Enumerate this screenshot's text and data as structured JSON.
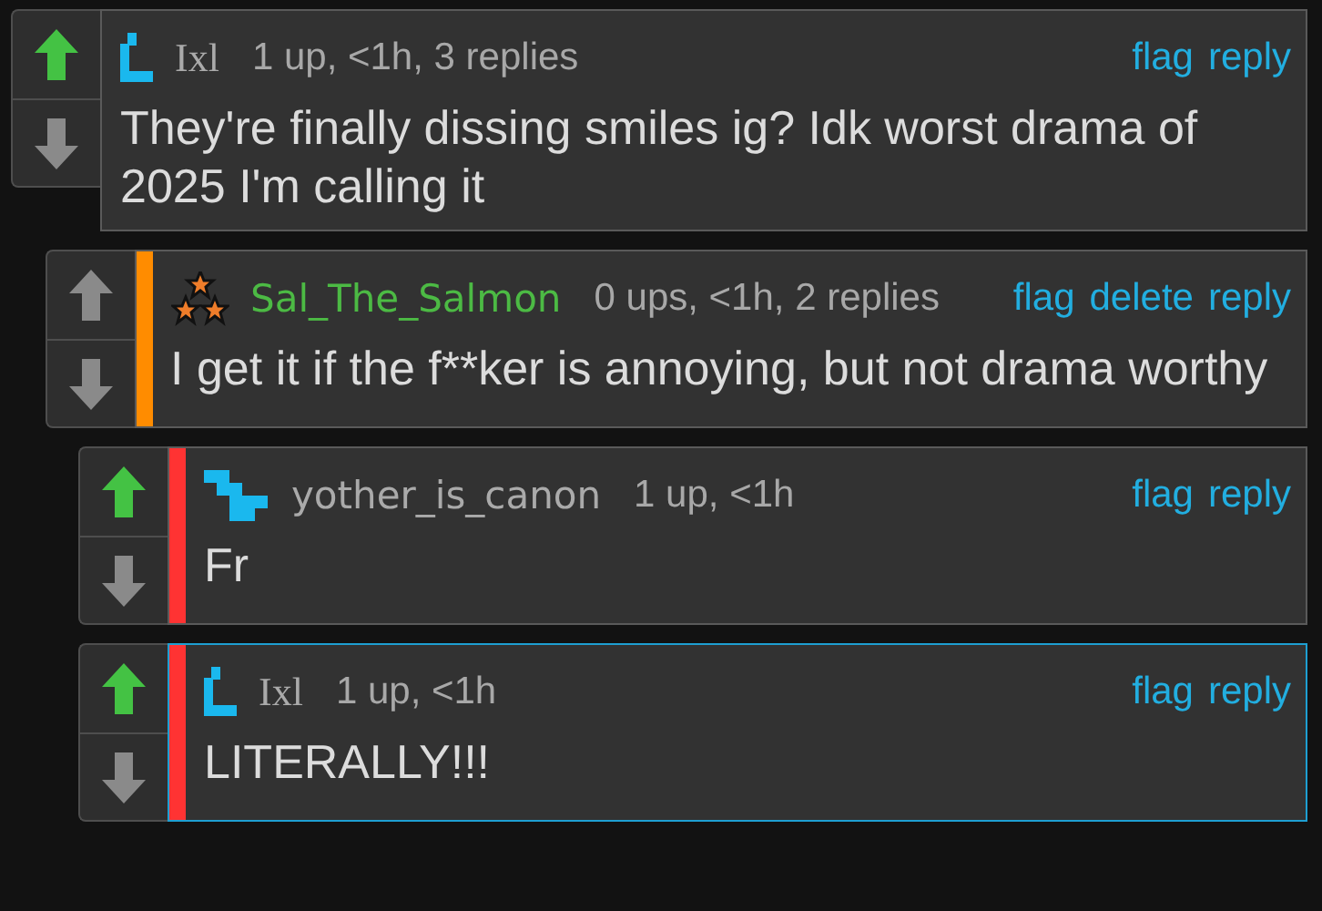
{
  "comments": [
    {
      "avatar": {
        "kind": "bracket"
      },
      "username": "Ixl",
      "serif_name": true,
      "color": "#aaaaaa",
      "meta": "1 up, <1h, 3 replies",
      "actions": [
        "flag",
        "reply"
      ],
      "upvoted": true,
      "highlighted": false,
      "text": "They're finally dissing smiles ig? Idk worst drama of 2025 I'm calling it",
      "children": [
        {
          "avatar": {
            "kind": "stars"
          },
          "username": "Sal_The_Salmon",
          "serif_name": false,
          "color": "#4cba44",
          "bar": {
            "color": "#ff8c00"
          },
          "meta": "0 ups, <1h, 2 replies",
          "actions": [
            "flag",
            "delete",
            "reply"
          ],
          "upvoted": false,
          "highlighted": false,
          "text": "I get it if the f**ker is annoying, but not drama worthy",
          "children": [
            {
              "avatar": {
                "kind": "checker"
              },
              "username": "yother_is_canon",
              "serif_name": false,
              "color": "#aaaaaa",
              "bar": {
                "color": "#ff3333"
              },
              "meta": "1 up, <1h",
              "actions": [
                "flag",
                "reply"
              ],
              "upvoted": true,
              "highlighted": false,
              "text": "Fr"
            },
            {
              "avatar": {
                "kind": "bracket"
              },
              "username": "Ixl",
              "serif_name": true,
              "color": "#aaaaaa",
              "bar": {
                "color": "#ff3333"
              },
              "meta": "1 up, <1h",
              "actions": [
                "flag",
                "reply"
              ],
              "upvoted": true,
              "highlighted": true,
              "text": "LITERALLY!!!"
            }
          ]
        }
      ]
    }
  ]
}
